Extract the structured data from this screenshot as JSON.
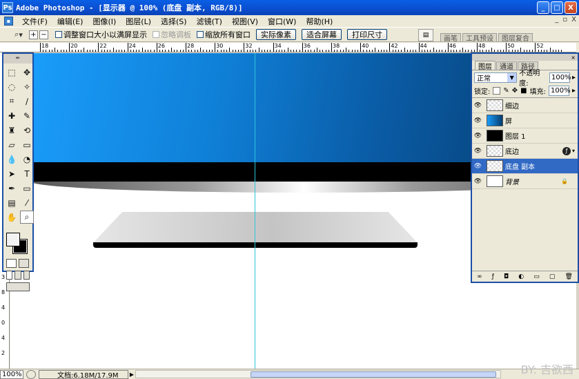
{
  "window": {
    "title": "Adobe Photoshop - [显示器 @ 100% (底盘 副本, RGB/8)]",
    "app_icon_glyph": "Ps",
    "controls": [
      "_",
      "□",
      "X"
    ]
  },
  "menu": {
    "items": [
      "文件(F)",
      "编辑(E)",
      "图像(I)",
      "图层(L)",
      "选择(S)",
      "滤镜(T)",
      "视图(V)",
      "窗口(W)",
      "帮助(H)"
    ],
    "doc_controls": [
      "_",
      "▫",
      "X"
    ]
  },
  "options": {
    "zoom_tool_glyph": "🔍",
    "checkbox_resize": "调整窗口大小以满屏显示",
    "checkbox_ignore_palettes": "忽略调板",
    "checkbox_zoom_all": "缩放所有窗口",
    "btn_actual_pixels": "实际像素",
    "btn_fit_screen": "适合屏幕",
    "btn_print_size": "打印尺寸",
    "palette_tabs": [
      "画笔",
      "工具预设",
      "图层复合"
    ]
  },
  "ruler": {
    "h_labels": [
      "18",
      "20",
      "22",
      "24",
      "26",
      "28",
      "30",
      "32",
      "34",
      "36",
      "38",
      "40",
      "42",
      "44",
      "46",
      "48",
      "50",
      "52"
    ],
    "v_labels": [
      "3",
      "8",
      "4",
      "0",
      "4",
      "2"
    ]
  },
  "layers_panel": {
    "tabs": [
      "图层",
      "通道",
      "路径"
    ],
    "blend_mode": "正常",
    "opacity_label": "不透明度:",
    "opacity_value": "100%",
    "lock_label": "锁定:",
    "fill_label": "填充:",
    "fill_value": "100%",
    "layers": [
      {
        "name": "细边",
        "thumb": "checker",
        "selected": false,
        "italic": false,
        "fx": false,
        "locked": false
      },
      {
        "name": "屏",
        "thumb": "blue",
        "selected": false,
        "italic": false,
        "fx": false,
        "locked": false
      },
      {
        "name": "图层 1",
        "thumb": "black",
        "selected": false,
        "italic": false,
        "fx": false,
        "locked": false
      },
      {
        "name": "底边",
        "thumb": "checker",
        "selected": false,
        "italic": false,
        "fx": true,
        "locked": false
      },
      {
        "name": "底盘 副本",
        "thumb": "checker",
        "selected": true,
        "italic": false,
        "fx": false,
        "locked": false
      },
      {
        "name": "背景",
        "thumb": "white",
        "selected": false,
        "italic": true,
        "fx": false,
        "locked": true
      }
    ]
  },
  "status": {
    "zoom": "100%",
    "doc_info": "文档:6.18M/17.9M"
  },
  "watermark": "BY: 吉欲西"
}
